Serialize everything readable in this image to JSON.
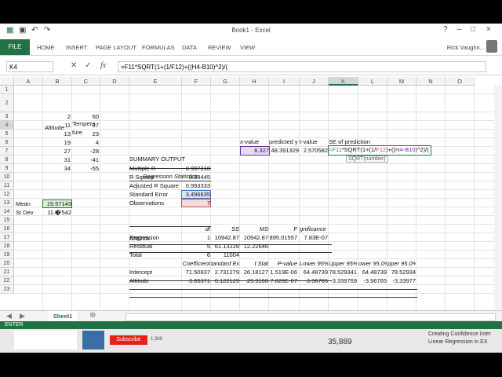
{
  "window": {
    "title": "Book1 - Excel",
    "user": "Rick Vaughn...",
    "controls": [
      "?",
      "–",
      "□",
      "×"
    ]
  },
  "ribbon": {
    "file": "FILE",
    "tabs": [
      "HOME",
      "INSERT",
      "PAGE LAYOUT",
      "FORMULAS",
      "DATA",
      "REVIEW",
      "VIEW"
    ]
  },
  "formula_bar": {
    "name_box": "K4",
    "fx": "fx",
    "formula": "=F11*SQRT(1+(1/F12)+((H4-B10)^2)/("
  },
  "columns": [
    "A",
    "B",
    "C",
    "D",
    "E",
    "F",
    "G",
    "H",
    "I",
    "J",
    "K",
    "L",
    "M",
    "N",
    "O"
  ],
  "rows": [
    "1",
    "2",
    "3",
    "4",
    "5",
    "6",
    "7",
    "8",
    "9",
    "10",
    "11",
    "12",
    "13",
    "14",
    "15",
    "16",
    "17",
    "18",
    "19",
    "20",
    "21",
    "22",
    "23"
  ],
  "cells": {
    "altitude_header": "Altitude",
    "temp_header_1": "Tempera",
    "temp_header_2": "ture",
    "altitude": [
      "2",
      "11",
      "13",
      "19",
      "27",
      "31",
      "34"
    ],
    "temperature": [
      "60",
      "37",
      "23",
      "4",
      "-28",
      "-41",
      "-55"
    ],
    "mean_label": "Mean",
    "mean_value": "19.57143",
    "stdev_label": "St Dev",
    "stdev_value": "11.67542",
    "summary_output": "SUMMARY OUTPUT",
    "regression_statistics": "Regression Statistics",
    "stats_labels": [
      "Multiple R",
      "R Square",
      "Adjusted R Square",
      "Standard Error",
      "Observations"
    ],
    "stats_values": [
      "0.997218",
      "0.99445",
      "0.993333",
      "3.496635",
      "7"
    ],
    "anova": "ANOVA",
    "anova_headers": [
      "df",
      "SS",
      "MS",
      "F",
      "gnificance F"
    ],
    "anova_rows": [
      {
        "label": "Regression",
        "df": "1",
        "ss": "10942.87",
        "ms": "10942.87",
        "f": "895.01557",
        "sig": "7.83E-07"
      },
      {
        "label": "Residual",
        "df": "5",
        "ss": "61.13228",
        "ms": "12.22646",
        "f": "",
        "sig": ""
      },
      {
        "label": "Total",
        "df": "6",
        "ss": "11004",
        "ms": "",
        "f": "",
        "sig": ""
      }
    ],
    "coef_headers": [
      "Coefficient",
      "tandard Erro",
      "t Stat",
      "P-value",
      "Lower 95%",
      "Upper 95%",
      "ower 95.0%",
      "pper 95.0%"
    ],
    "coef_rows": [
      {
        "label": "Intercept",
        "vals": [
          "71.50837",
          "2.731279",
          "26.18127",
          "1.519E-06",
          "64.48739",
          "78.529341",
          "64.48739",
          "78.52934"
        ]
      },
      {
        "label": "Altitude",
        "vals": [
          "-3.65371",
          "0.122129",
          "-29.9168",
          "7.826E-07",
          "-3.96765",
          "-3.339769",
          "-3.96765",
          "-3.33977"
        ]
      }
    ],
    "xvalue_header": "x-value",
    "predicted_header": "predicted y",
    "tvalue_header": "t-value",
    "se_header": "SE of prediction",
    "xvalue": "6.327",
    "predicted": "48.391329",
    "tvalue": "2.570582",
    "k4_formula": "=F11*SQRT(1+(1/F12)+((H4-B10)^2)/(",
    "tooltip": "SQRT(number)"
  },
  "sheet_tabs": [
    "Sheet1"
  ],
  "status": "ENTER",
  "taskbar": {
    "subscribe": "Subscribe",
    "sub_count": "1,386",
    "num": "35,889",
    "video_title_1": "Creating Confidence Inter",
    "video_title_2": "Linear Regression in EX"
  },
  "colors": {
    "excel_green": "#217346",
    "ref_blue": "#4472c4",
    "ref_red": "#c0504d",
    "ref_purple": "#7030a0"
  }
}
